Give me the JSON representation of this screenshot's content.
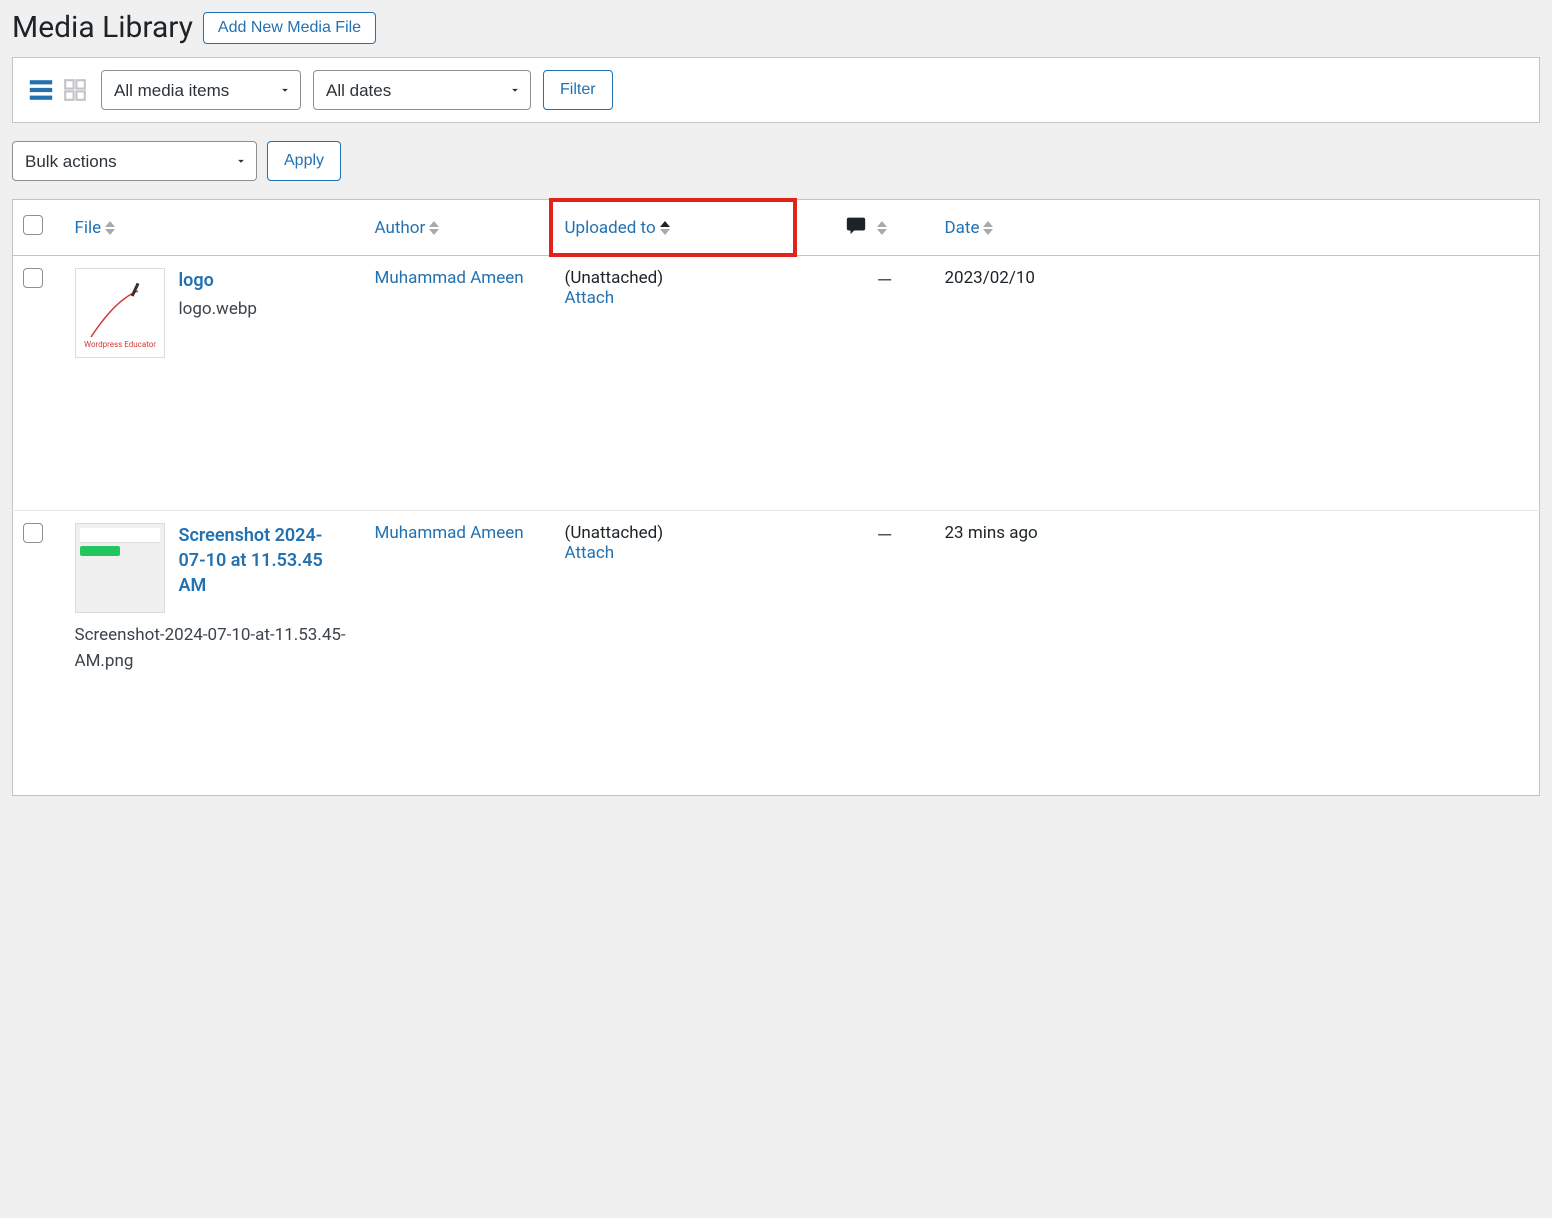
{
  "header": {
    "title": "Media Library",
    "add_new_label": "Add New Media File"
  },
  "filter_bar": {
    "media_type_selected": "All media items",
    "dates_selected": "All dates",
    "filter_label": "Filter"
  },
  "bulk": {
    "selected": "Bulk actions",
    "apply_label": "Apply"
  },
  "columns": {
    "file": "File",
    "author": "Author",
    "uploaded_to": "Uploaded to",
    "date": "Date"
  },
  "rows": [
    {
      "title": "logo",
      "filename": "logo.webp",
      "author": "Muhammad Ameen",
      "uploaded_status": "(Unattached)",
      "attach_label": "Attach",
      "comments": "—",
      "date": "2023/02/10",
      "thumb_text": "Wordpress Educator"
    },
    {
      "title": "Screenshot 2024-07-10 at 11.53.45 AM",
      "filename": "Screenshot-2024-07-10-at-11.53.45-AM.png",
      "author": "Muhammad Ameen",
      "uploaded_status": "(Unattached)",
      "attach_label": "Attach",
      "comments": "—",
      "date": "23 mins ago"
    }
  ],
  "highlight_column": "uploaded_to"
}
